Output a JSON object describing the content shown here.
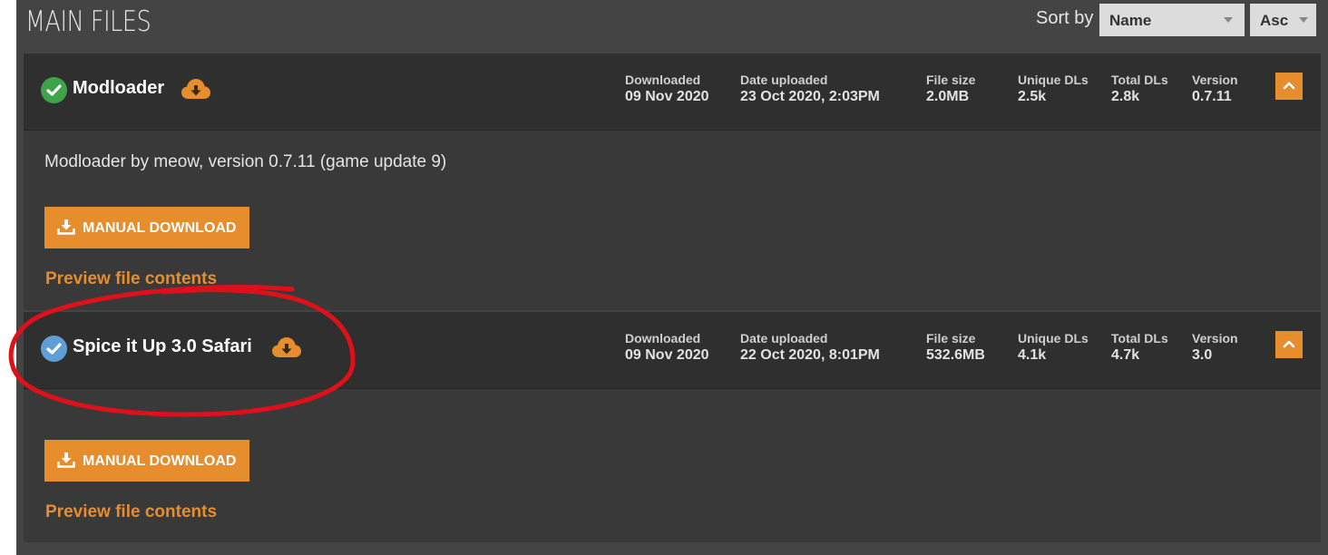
{
  "section": {
    "title": "MAIN FILES"
  },
  "sort": {
    "label": "Sort by",
    "field": "Name",
    "direction": "Asc"
  },
  "stat_labels": {
    "downloaded": "Downloaded",
    "date_uploaded": "Date uploaded",
    "file_size": "File size",
    "unique_dls": "Unique DLs",
    "total_dls": "Total DLs",
    "version": "Version"
  },
  "files": [
    {
      "name": "Modloader",
      "status": "downloaded-check",
      "downloaded": "09 Nov 2020",
      "date_uploaded": "23 Oct 2020, 2:03PM",
      "file_size": "2.0MB",
      "unique_dls": "2.5k",
      "total_dls": "2.8k",
      "version": "0.7.11",
      "description": "Modloader by meow, version 0.7.11 (game update 9)",
      "manual_download_label": "MANUAL DOWNLOAD",
      "preview_label": "Preview file contents"
    },
    {
      "name": "Spice it Up 3.0 Safari",
      "status": "downloaded-check",
      "downloaded": "09 Nov 2020",
      "date_uploaded": "22 Oct 2020, 8:01PM",
      "file_size": "532.6MB",
      "unique_dls": "4.1k",
      "total_dls": "4.7k",
      "version": "3.0",
      "description": "",
      "manual_download_label": "MANUAL DOWNLOAD",
      "preview_label": "Preview file contents"
    }
  ],
  "colors": {
    "accent": "#e68d2e",
    "status_green": "#3ea34a",
    "status_blue": "#5d9fd6",
    "annotation_red": "#e0101a"
  }
}
